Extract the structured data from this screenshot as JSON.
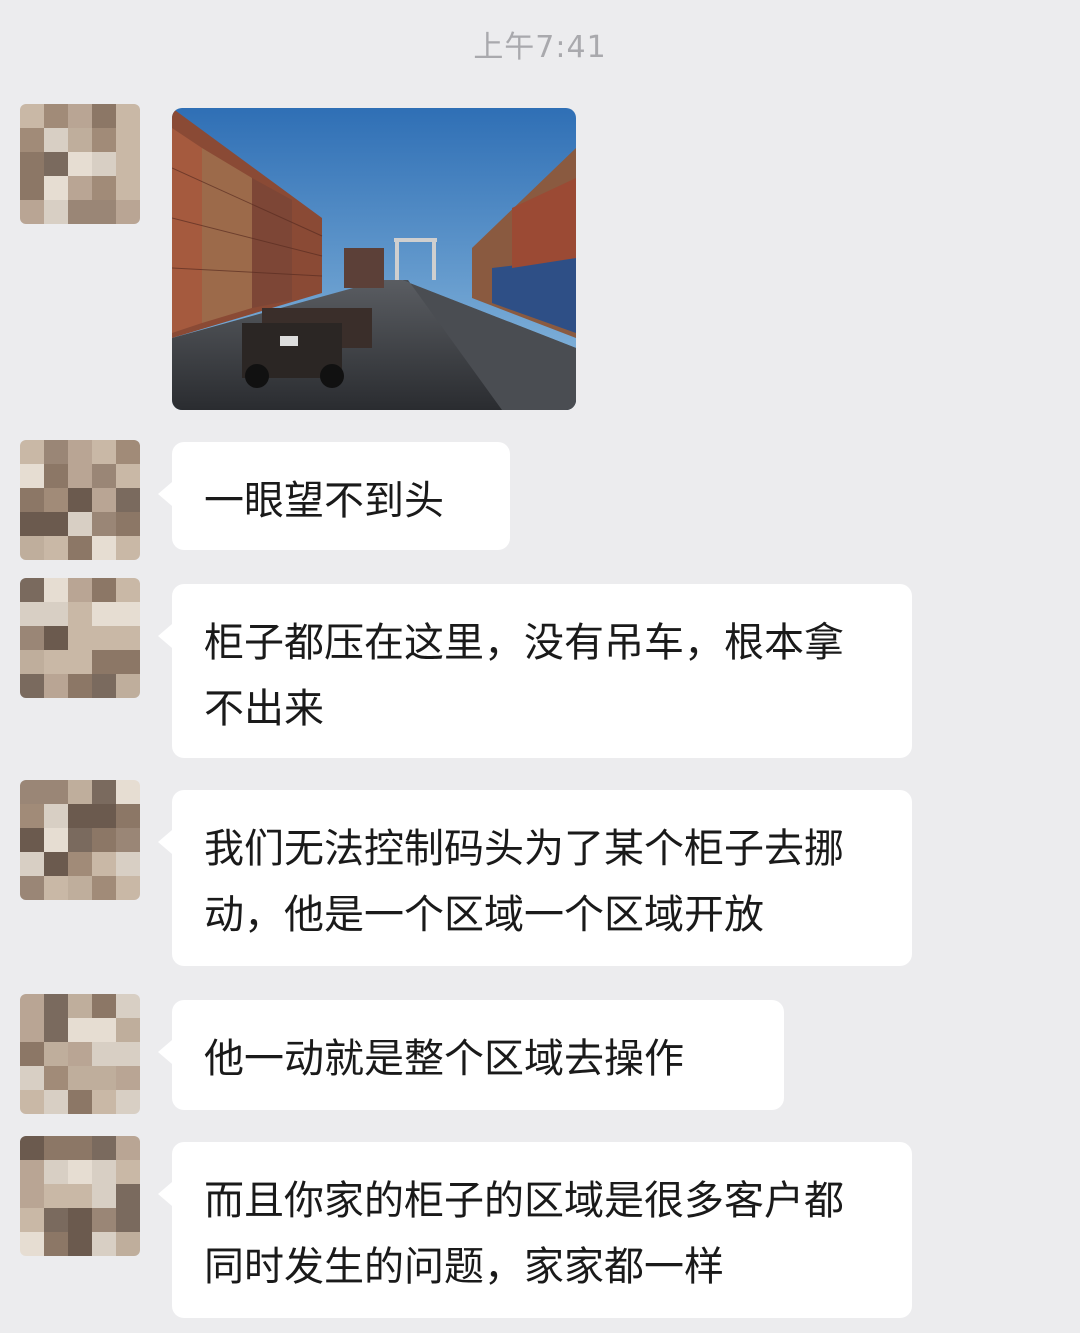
{
  "header": {
    "timestamp": "上午7:41"
  },
  "conversation": {
    "image_message": {
      "description_icon": "photo-container-terminal"
    },
    "messages": [
      {
        "text": "一眼望不到头"
      },
      {
        "text": "柜子都压在这里，没有吊车，根本拿不出来"
      },
      {
        "text": "我们无法控制码头为了某个柜子去挪动，他是一个区域一个区域开放"
      },
      {
        "text": "他一动就是整个区域去操作"
      },
      {
        "text": "而且你家的柜子的区域是很多客户都同时发生的问题，家家都一样"
      }
    ]
  },
  "colors": {
    "background": "#ececee",
    "bubble": "#ffffff",
    "text": "#1a1a1a",
    "timestamp": "#a9a9ad"
  }
}
